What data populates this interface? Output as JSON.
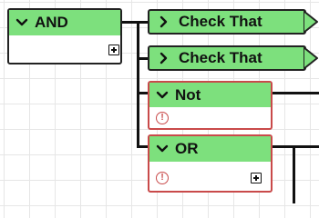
{
  "blocks": {
    "and_block": {
      "label": "AND",
      "chevron": "chevron-down-icon",
      "expand": "expand-plus-icon"
    },
    "check1": {
      "label": "Check That",
      "chevron": "chevron-right-icon"
    },
    "check2": {
      "label": "Check That",
      "chevron": "chevron-right-icon"
    },
    "not_block": {
      "label": "Not",
      "chevron": "chevron-down-icon",
      "status": "error",
      "status_icon": "error-exclamation-icon",
      "status_glyph": "!"
    },
    "or_block": {
      "label": "OR",
      "chevron": "chevron-down-icon",
      "status": "error",
      "status_icon": "error-exclamation-icon",
      "status_glyph": "!",
      "expand": "expand-plus-icon"
    }
  },
  "colors": {
    "header": "#7de07d",
    "border": "#222222",
    "error": "#c94a4a",
    "grid": "#e6e6e6"
  }
}
